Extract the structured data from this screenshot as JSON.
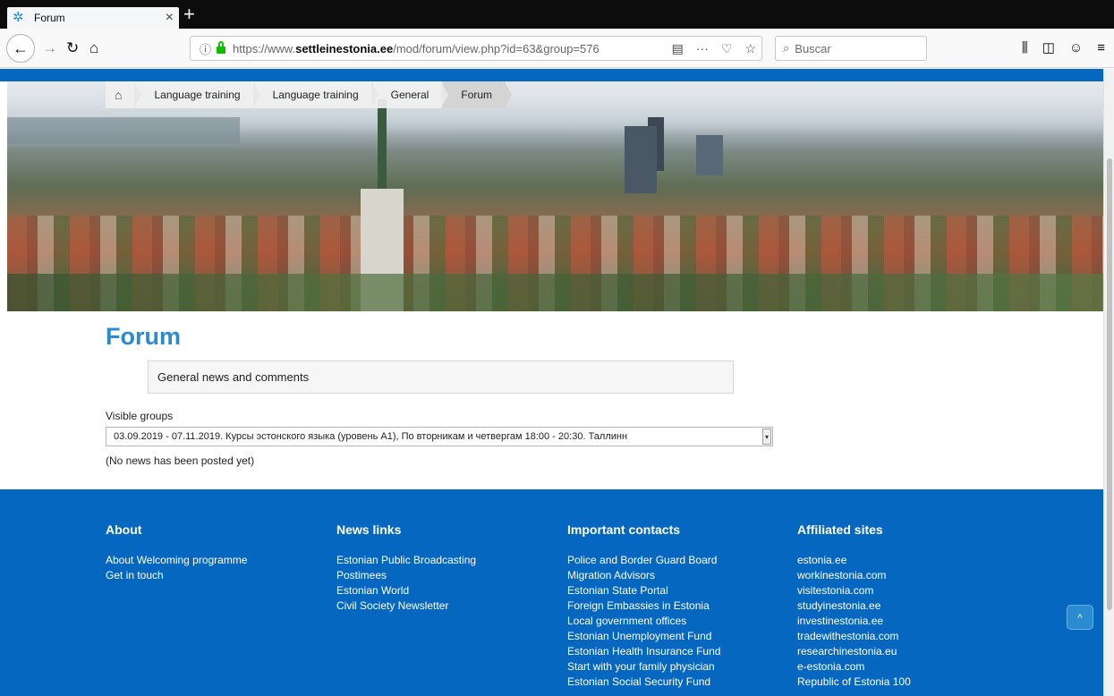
{
  "browser": {
    "tab_title": "Forum",
    "tab_close": "×",
    "new_tab": "+",
    "url_prefix": "https://www.",
    "url_domain": "settleinestonia.ee",
    "url_path": "/mod/forum/view.php?id=63&group=576",
    "search_placeholder": "Buscar",
    "icons": {
      "back": "back-arrow-icon",
      "forward": "forward-arrow-icon",
      "reload": "reload-icon",
      "home": "home-icon",
      "info": "info-icon",
      "lock": "lock-icon",
      "reader": "reader-view-icon",
      "more": "more-icon",
      "pocket": "pocket-icon",
      "bookmark": "star-icon",
      "search": "search-icon",
      "library": "library-icon",
      "sidebar": "sidebar-icon",
      "account": "account-icon",
      "menu": "hamburger-menu-icon"
    }
  },
  "breadcrumb": {
    "items": [
      "Language training",
      "Language training",
      "General",
      "Forum"
    ]
  },
  "main": {
    "title": "Forum",
    "intro": "General news and comments",
    "groups_label": "Visible groups",
    "group_selected": "03.09.2019 - 07.11.2019. Курсы эстонского языка (уровень A1), По вторникам и четвергам 18:00 - 20:30. Таллинн",
    "empty_message": "(No news has been posted yet)"
  },
  "footer": {
    "about": {
      "title": "About",
      "links": [
        "About Welcoming programme",
        "Get in touch"
      ]
    },
    "news": {
      "title": "News links",
      "links": [
        "Estonian Public Broadcasting",
        "Postimees",
        "Estonian World",
        "Civil Society Newsletter"
      ]
    },
    "contacts": {
      "title": "Important contacts",
      "links": [
        "Police and Border Guard Board",
        "Migration Advisors",
        "Estonian State Portal",
        "Foreign Embassies in Estonia",
        "Local government offices",
        "Estonian Unemployment Fund",
        "Estonian Health Insurance Fund",
        "Start with your family physician",
        "Estonian Social Security Fund"
      ]
    },
    "affiliated": {
      "title": "Affiliated sites",
      "links": [
        "estonia.ee",
        "workinestonia.com",
        "visitestonia.com",
        "studyinestonia.ee",
        "investinestonia.ee",
        "tradewithestonia.com",
        "researchinestonia.eu",
        "e-estonia.com",
        "Republic of Estonia 100"
      ]
    }
  },
  "colors": {
    "brand_blue": "#0567bf",
    "title_blue": "#2a8bd0"
  }
}
